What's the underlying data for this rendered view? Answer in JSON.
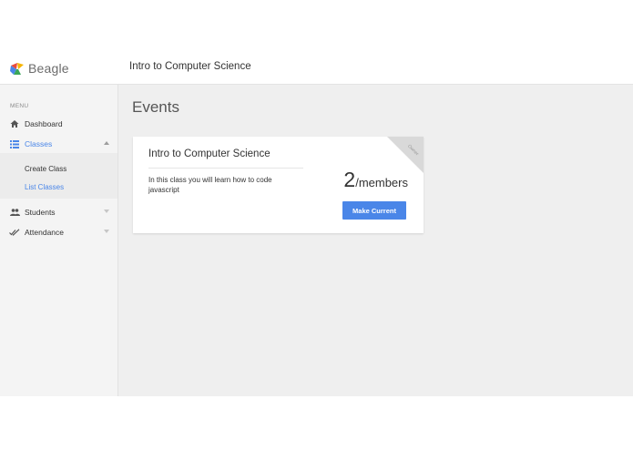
{
  "brand": {
    "name": "Beagle"
  },
  "header": {
    "title": "Intro to Computer Science"
  },
  "sidebar": {
    "menu_label": "MENU",
    "items": [
      {
        "label": "Dashboard",
        "icon": "home-icon"
      },
      {
        "label": "Classes",
        "icon": "list-icon",
        "active": true,
        "expanded": true
      },
      {
        "label": "Students",
        "icon": "people-icon"
      },
      {
        "label": "Attendance",
        "icon": "double-check-icon"
      }
    ],
    "submenu": [
      {
        "label": "Create Class"
      },
      {
        "label": "List Classes",
        "active": true
      }
    ]
  },
  "main": {
    "title": "Events",
    "card": {
      "title": "Intro to Computer Science",
      "description": "In this class you will learn how to code javascript",
      "count": "2",
      "count_unit": "/members",
      "button_label": "Make Current",
      "ribbon_label": "Owner"
    }
  },
  "colors": {
    "accent": "#4a86e8",
    "sidebar_bg": "#f4f4f4",
    "main_bg": "#efefef"
  }
}
